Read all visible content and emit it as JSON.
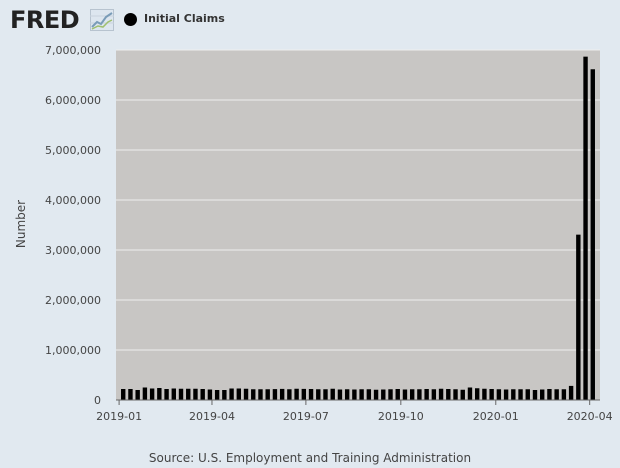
{
  "header": {
    "logo_text": "FRED",
    "logo_icon": "line-graph-icon",
    "legend_label": "Initial Claims",
    "legend_color": "#000000"
  },
  "source": "Source: U.S. Employment and Training Administration",
  "chart_data": {
    "type": "bar",
    "ylabel": "Number",
    "xlabel": "",
    "title": "",
    "ylim": [
      0,
      7000000
    ],
    "yticks": [
      0,
      1000000,
      2000000,
      3000000,
      4000000,
      5000000,
      6000000,
      7000000
    ],
    "ytick_labels": [
      "0",
      "1,000,000",
      "2,000,000",
      "3,000,000",
      "4,000,000",
      "5,000,000",
      "6,000,000",
      "7,000,000"
    ],
    "xlim": [
      "2018-12-29",
      "2020-04-11"
    ],
    "xticks": [
      "2019-01-01",
      "2019-04-01",
      "2019-07-01",
      "2019-10-01",
      "2020-01-01",
      "2020-04-01"
    ],
    "xtick_labels": [
      "2019-01",
      "2019-04",
      "2019-07",
      "2019-10",
      "2020-01",
      "2020-04"
    ],
    "grid": true,
    "plot_background": "#c8c6c4",
    "bar_color": "#000000",
    "series": [
      {
        "name": "Initial Claims",
        "x": [
          "2019-01-05",
          "2019-01-12",
          "2019-01-19",
          "2019-01-26",
          "2019-02-02",
          "2019-02-09",
          "2019-02-16",
          "2019-02-23",
          "2019-03-02",
          "2019-03-09",
          "2019-03-16",
          "2019-03-23",
          "2019-03-30",
          "2019-04-06",
          "2019-04-13",
          "2019-04-20",
          "2019-04-27",
          "2019-05-04",
          "2019-05-11",
          "2019-05-18",
          "2019-05-25",
          "2019-06-01",
          "2019-06-08",
          "2019-06-15",
          "2019-06-22",
          "2019-06-29",
          "2019-07-06",
          "2019-07-13",
          "2019-07-20",
          "2019-07-27",
          "2019-08-03",
          "2019-08-10",
          "2019-08-17",
          "2019-08-24",
          "2019-08-31",
          "2019-09-07",
          "2019-09-14",
          "2019-09-21",
          "2019-09-28",
          "2019-10-05",
          "2019-10-12",
          "2019-10-19",
          "2019-10-26",
          "2019-11-02",
          "2019-11-09",
          "2019-11-16",
          "2019-11-23",
          "2019-11-30",
          "2019-12-07",
          "2019-12-14",
          "2019-12-21",
          "2019-12-28",
          "2020-01-04",
          "2020-01-11",
          "2020-01-18",
          "2020-01-25",
          "2020-02-01",
          "2020-02-08",
          "2020-02-15",
          "2020-02-22",
          "2020-02-29",
          "2020-03-07",
          "2020-03-14",
          "2020-03-21",
          "2020-03-28",
          "2020-04-04"
        ],
        "values": [
          220000,
          220000,
          200000,
          250000,
          230000,
          240000,
          220000,
          230000,
          225000,
          225000,
          225000,
          220000,
          210000,
          200000,
          200000,
          230000,
          230000,
          225000,
          215000,
          215000,
          215000,
          218000,
          222000,
          215000,
          225000,
          222000,
          220000,
          215000,
          215000,
          225000,
          210000,
          215000,
          210000,
          215000,
          215000,
          205000,
          210000,
          215000,
          220000,
          210000,
          215000,
          215000,
          220000,
          215000,
          225000,
          220000,
          215000,
          205000,
          250000,
          235000,
          225000,
          220000,
          215000,
          210000,
          215000,
          215000,
          215000,
          200000,
          210000,
          220000,
          215000,
          215000,
          282000,
          3307000,
          6867000,
          6615000
        ]
      }
    ]
  }
}
